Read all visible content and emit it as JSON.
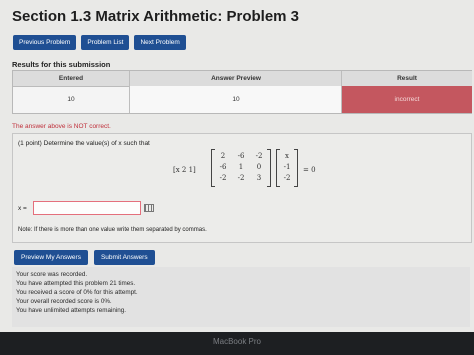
{
  "page": {
    "title": "Section 1.3 Matrix Arithmetic: Problem 3"
  },
  "nav": {
    "previous": "Previous Problem",
    "list": "Problem List",
    "next": "Next Problem"
  },
  "results": {
    "heading": "Results for this submission",
    "columns": [
      "Entered",
      "Answer Preview",
      "Result"
    ],
    "row": {
      "entered": "10",
      "preview": "10",
      "result": "incorrect"
    },
    "result_color": "#c4575f",
    "feedback": "The answer above is NOT correct."
  },
  "problem": {
    "prompt": "(1 point) Determine the value(s) of x such that",
    "row_vector": "[x  2  1]",
    "matrix": [
      [
        "2",
        "-6",
        "-2"
      ],
      [
        "-6",
        "1",
        "0"
      ],
      [
        "-2",
        "-2",
        "3"
      ]
    ],
    "column_vector": [
      "x",
      "-1",
      "-2"
    ],
    "rhs": "= 0",
    "answer_label": "x =",
    "answer_value": "",
    "note": "Note: If there is more than one value write them separated by commas."
  },
  "actions": {
    "preview": "Preview My Answers",
    "submit": "Submit Answers"
  },
  "messages": [
    "Your score was recorded.",
    "You have attempted this problem 21 times.",
    "You received a score of 0% for this attempt.",
    "Your overall recorded score is 0%.",
    "You have unlimited attempts remaining."
  ],
  "device": {
    "label": "MacBook Pro"
  },
  "colors": {
    "button": "#1f4f93",
    "error": "#bf2f3a"
  }
}
